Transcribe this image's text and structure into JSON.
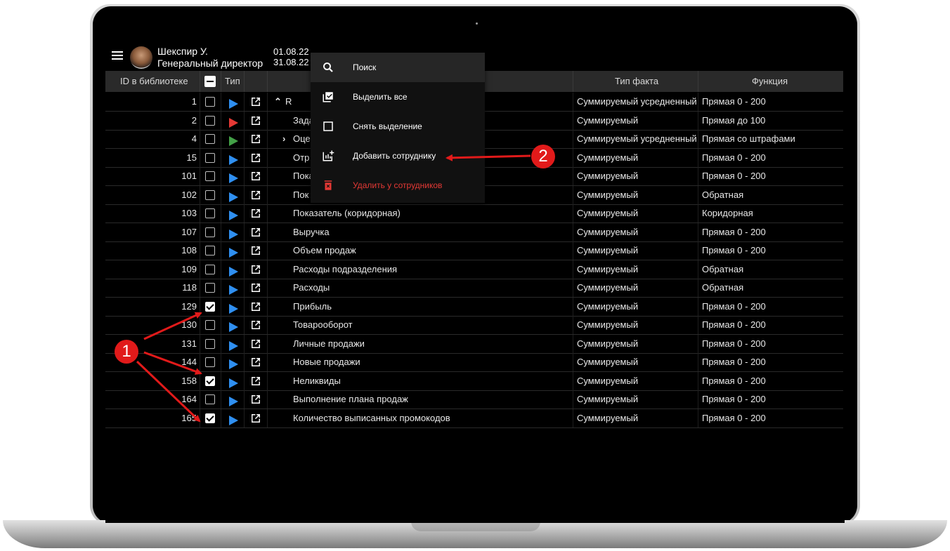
{
  "header": {
    "user_name": "Шекспир У.",
    "user_role": "Генеральный директор",
    "date_from": "01.08.22",
    "date_to": "31.08.22"
  },
  "table": {
    "columns": {
      "id": "ID в библиотеке",
      "type": "Тип",
      "fact_type": "Тип факта",
      "function": "Функция"
    },
    "rows": [
      {
        "id": "1",
        "checked": false,
        "color": "#2f8ff0",
        "name": "R",
        "prefix": "^",
        "fact": "Суммируемый усредненный",
        "func": "Прямая 0 - 200"
      },
      {
        "id": "2",
        "checked": false,
        "color": "#e53935",
        "name": "Зада",
        "prefix": "",
        "fact": "Суммируемый",
        "func": "Прямая до 100"
      },
      {
        "id": "4",
        "checked": false,
        "color": "#43a047",
        "name": "Оце",
        "prefix": ">",
        "fact": "Суммируемый усредненный",
        "func": "Прямая со штрафами"
      },
      {
        "id": "15",
        "checked": false,
        "color": "#2f8ff0",
        "name": "Отр",
        "prefix": "",
        "fact": "Суммируемый",
        "func": "Прямая 0 - 200"
      },
      {
        "id": "101",
        "checked": false,
        "color": "#2f8ff0",
        "name": "Пока",
        "prefix": "",
        "fact": "Суммируемый",
        "func": "Прямая 0 - 200"
      },
      {
        "id": "102",
        "checked": false,
        "color": "#2f8ff0",
        "name": "Пок",
        "prefix": "",
        "fact": "Суммируемый",
        "func": "Обратная"
      },
      {
        "id": "103",
        "checked": false,
        "color": "#2f8ff0",
        "name": "Показатель (коридорная)",
        "prefix": "",
        "fact": "Суммируемый",
        "func": "Коридорная"
      },
      {
        "id": "107",
        "checked": false,
        "color": "#2f8ff0",
        "name": "Выручка",
        "prefix": "",
        "fact": "Суммируемый",
        "func": "Прямая 0 - 200"
      },
      {
        "id": "108",
        "checked": false,
        "color": "#2f8ff0",
        "name": "Объем продаж",
        "prefix": "",
        "fact": "Суммируемый",
        "func": "Прямая 0 - 200"
      },
      {
        "id": "109",
        "checked": false,
        "color": "#2f8ff0",
        "name": "Расходы подразделения",
        "prefix": "",
        "fact": "Суммируемый",
        "func": "Обратная"
      },
      {
        "id": "118",
        "checked": false,
        "color": "#2f8ff0",
        "name": "Расходы",
        "prefix": "",
        "fact": "Суммируемый",
        "func": "Обратная"
      },
      {
        "id": "129",
        "checked": true,
        "color": "#2f8ff0",
        "name": "Прибыль",
        "prefix": "",
        "fact": "Суммируемый",
        "func": "Прямая 0 - 200"
      },
      {
        "id": "130",
        "checked": false,
        "color": "#2f8ff0",
        "name": "Товарооборот",
        "prefix": "",
        "fact": "Суммируемый",
        "func": "Прямая 0 - 200"
      },
      {
        "id": "131",
        "checked": false,
        "color": "#2f8ff0",
        "name": "Личные продажи",
        "prefix": "",
        "fact": "Суммируемый",
        "func": "Прямая 0 - 200"
      },
      {
        "id": "144",
        "checked": false,
        "color": "#2f8ff0",
        "name": "Новые продажи",
        "prefix": "",
        "fact": "Суммируемый",
        "func": "Прямая 0 - 200"
      },
      {
        "id": "158",
        "checked": true,
        "color": "#2f8ff0",
        "name": "Неликвиды",
        "prefix": "",
        "fact": "Суммируемый",
        "func": "Прямая 0 - 200"
      },
      {
        "id": "164",
        "checked": false,
        "color": "#2f8ff0",
        "name": "Выполнение плана продаж",
        "prefix": "",
        "fact": "Суммируемый",
        "func": "Прямая 0 - 200"
      },
      {
        "id": "165",
        "checked": true,
        "color": "#2f8ff0",
        "name": "Количество выписанных промокодов",
        "prefix": "",
        "fact": "Суммируемый",
        "func": "Прямая 0 - 200"
      }
    ]
  },
  "menu": {
    "items": [
      {
        "label": "Поиск",
        "icon": "search-icon",
        "active": true
      },
      {
        "label": "Выделить все",
        "icon": "select-all-icon"
      },
      {
        "label": "Снять выделение",
        "icon": "deselect-icon"
      },
      {
        "label": "Добавить сотруднику",
        "icon": "add-chart-icon"
      },
      {
        "label": "Удалить у сотрудников",
        "icon": "delete-icon",
        "danger": true
      }
    ]
  },
  "annotations": {
    "one": "1",
    "two": "2",
    "color": "#e11a1a"
  }
}
